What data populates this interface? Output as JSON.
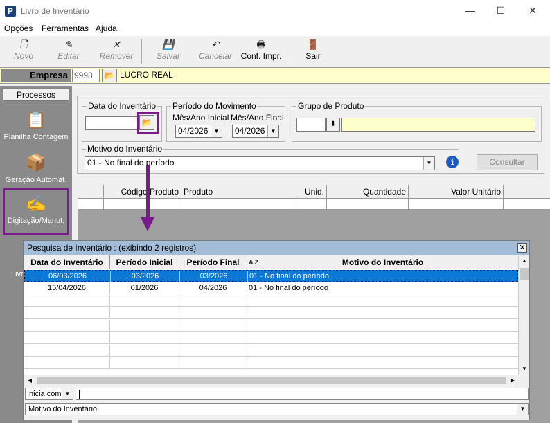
{
  "window": {
    "title": "Livro de Inventário",
    "app_icon": "P",
    "min": "—",
    "max": "☐",
    "close": "✕"
  },
  "menu": [
    "Opções",
    "Ferramentas",
    "Ajuda"
  ],
  "toolbar": {
    "novo": "Novo",
    "editar": "Editar",
    "remover": "Remover",
    "salvar": "Salvar",
    "cancelar": "Cancelar",
    "conf_impr": "Conf. Impr.",
    "sair": "Sair"
  },
  "empresa": {
    "label": "Empresa",
    "code": "9998",
    "name": "LUCRO REAL"
  },
  "sidebar": {
    "header": "Processos",
    "items": [
      "Planilha Contagem",
      "Geração Automát.",
      "Digitação/Manut."
    ],
    "partial_text": "Livr"
  },
  "form": {
    "data_inventario_label": "Data do Inventário",
    "data_inventario_value": "",
    "periodo_label": "Período do Movimento",
    "mes_inicial_label": "Mês/Ano Inicial",
    "mes_inicial_value": "04/2026",
    "mes_final_label": "Mês/Ano Final",
    "mes_final_value": "04/2026",
    "grupo_label": "Grupo de Produto",
    "grupo_code": "",
    "grupo_name": "",
    "motivo_label": "Motivo do Inventário",
    "motivo_value": "01 - No final do período",
    "info_icon": "i",
    "consultar": "Consultar"
  },
  "grid": {
    "columns": [
      "",
      "Código Produto",
      "Produto",
      "Unid.",
      "Quantidade",
      "Valor Unitário"
    ]
  },
  "popup": {
    "title": "Pesquisa de Inventário : (exibindo 2 registros)",
    "columns": [
      "Data do Inventário",
      "Período Inicial",
      "Período Final",
      "Motivo do Inventário"
    ],
    "sort_indicator": "A Z",
    "rows": [
      [
        "06/03/2026",
        "03/2026",
        "03/2026",
        "01 - No final do período"
      ],
      [
        "15/04/2026",
        "01/2026",
        "04/2026",
        "01 - No final do período"
      ]
    ],
    "search_mode": "Inicia com",
    "search_value": "",
    "search_field": "Motivo do Inventário"
  }
}
